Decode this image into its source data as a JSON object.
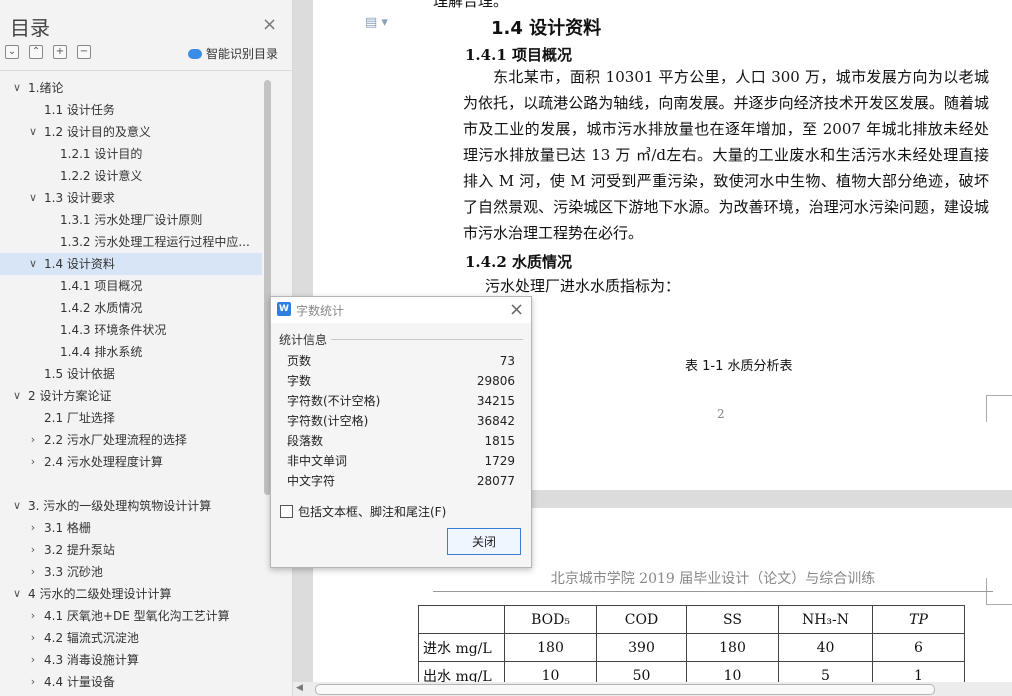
{
  "nav": {
    "title": "目录",
    "smart_toc": "智能识别目录",
    "tool_expand_all": "⌄",
    "tool_collapse_all": "⌃",
    "tool_promote": "+",
    "tool_demote": "−",
    "items": [
      {
        "label": "1.绪论",
        "arrow": "∨"
      },
      {
        "label": "1.1 设计任务",
        "arrow": ""
      },
      {
        "label": "1.2 设计目的及意义",
        "arrow": "∨"
      },
      {
        "label": "1.2.1 设计目的",
        "arrow": ""
      },
      {
        "label": "1.2.2 设计意义",
        "arrow": ""
      },
      {
        "label": "1.3 设计要求",
        "arrow": "∨"
      },
      {
        "label": "1.3.1 污水处理厂设计原则",
        "arrow": ""
      },
      {
        "label": "1.3.2 污水处理工程运行过程中应...",
        "arrow": ""
      },
      {
        "label": "1.4 设计资料",
        "arrow": "∨"
      },
      {
        "label": "1.4.1 项目概况",
        "arrow": ""
      },
      {
        "label": "1.4.2 水质情况",
        "arrow": ""
      },
      {
        "label": "1.4.3 环境条件状况",
        "arrow": ""
      },
      {
        "label": "1.4.4 排水系统",
        "arrow": ""
      },
      {
        "label": "1.5 设计依据",
        "arrow": ""
      },
      {
        "label": "2 设计方案论证",
        "arrow": "∨"
      },
      {
        "label": "2.1 厂址选择",
        "arrow": ""
      },
      {
        "label": "2.2 污水厂处理流程的选择",
        "arrow": "›"
      },
      {
        "label": "2.4 污水处理程度计算",
        "arrow": "›"
      },
      {
        "label": "3. 污水的一级处理构筑物设计计算",
        "arrow": "∨"
      },
      {
        "label": "3.1 格栅",
        "arrow": "›"
      },
      {
        "label": "3.2 提升泵站",
        "arrow": "›"
      },
      {
        "label": "3.3 沉砂池",
        "arrow": "›"
      },
      {
        "label": "4 污水的二级处理设计计算",
        "arrow": "∨"
      },
      {
        "label": "4.1 厌氧池+DE 型氧化沟工艺计算",
        "arrow": "›"
      },
      {
        "label": "4.2 辐流式沉淀池",
        "arrow": "›"
      },
      {
        "label": "4.3 消毒设施计算",
        "arrow": "›"
      },
      {
        "label": "4.4 计量设备",
        "arrow": "›"
      }
    ]
  },
  "doc": {
    "prev_line_fragment": "理解合理。",
    "heading_14": "1.4 设计资料",
    "heading_141": "1.4.1 项目概况",
    "paragraph_141": "东北某市，面积 10301 平方公里，人口 300 万，城市发展方向为以老城为依托，以疏港公路为轴线，向南发展。并逐步向经济技术开发区发展。随着城市及工业的发展，城市污水排放量也在逐年增加，至 2007 年城北排放未经处理污水排放量已达 13 万 ㎥/d左右。大量的工业废水和生活污水未经处理直接排入 M 河，使 M 河受到严重污染，致使河水中生物、植物大部分绝迹，破坏了自然景观、污染城区下游地下水源。为改善环境，治理河水污染问题，建设城市污水治理工程势在必行。",
    "heading_142": "1.4.2 水质情况",
    "paragraph_142": "污水处理厂进水水质指标为：",
    "table_caption": "表 1-1  水质分析表",
    "page_number": "2",
    "page2_header": "北京城市学院 2019 届毕业设计（论文）与综合训练",
    "table": {
      "header": [
        "",
        "BOD₅",
        "COD",
        "SS",
        "NH₃-N",
        "TP"
      ],
      "rows": [
        [
          "进水 mg/L",
          "180",
          "390",
          "180",
          "40",
          "6"
        ],
        [
          "出水 mg/L",
          "10",
          "50",
          "10",
          "5",
          "1"
        ]
      ]
    }
  },
  "dialog": {
    "title": "字数统计",
    "section": "统计信息",
    "stats": [
      {
        "label": "页数",
        "value": "73"
      },
      {
        "label": "字数",
        "value": "29806"
      },
      {
        "label": "字符数(不计空格)",
        "value": "34215"
      },
      {
        "label": "字符数(计空格)",
        "value": "36842"
      },
      {
        "label": "段落数",
        "value": "1815"
      },
      {
        "label": "非中文单词",
        "value": "1729"
      },
      {
        "label": "中文字符",
        "value": "28077"
      }
    ],
    "checkbox_label": "包括文本框、脚注和尾注(F)",
    "close_button": "关闭"
  },
  "colors": {
    "accent": "#3a7bd5",
    "selection": "#d7e5f6",
    "logo": "#2f7fe0"
  }
}
